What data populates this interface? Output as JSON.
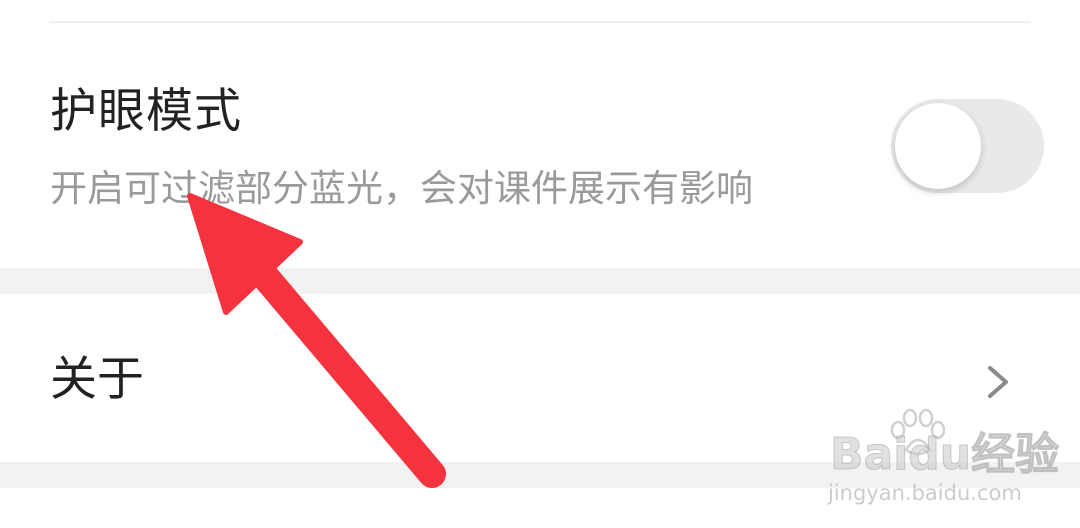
{
  "settings": {
    "eye_mode": {
      "title": "护眼模式",
      "description": "开启可过滤部分蓝光，会对课件展示有影响",
      "toggle_on": false
    },
    "about": {
      "label": "关于",
      "chevron_icon": "chevron-right-icon"
    }
  },
  "watermark": {
    "brand": "Baidu经验",
    "url": "jingyan.baidu.com"
  },
  "annotation": {
    "arrow_icon": "red-arrow-icon",
    "color": "#f5333f"
  },
  "colors": {
    "background": "#f2f2f2",
    "card": "#ffffff",
    "title_text": "#222222",
    "desc_text": "#9a9a9a",
    "toggle_off": "#e9e9ea"
  }
}
